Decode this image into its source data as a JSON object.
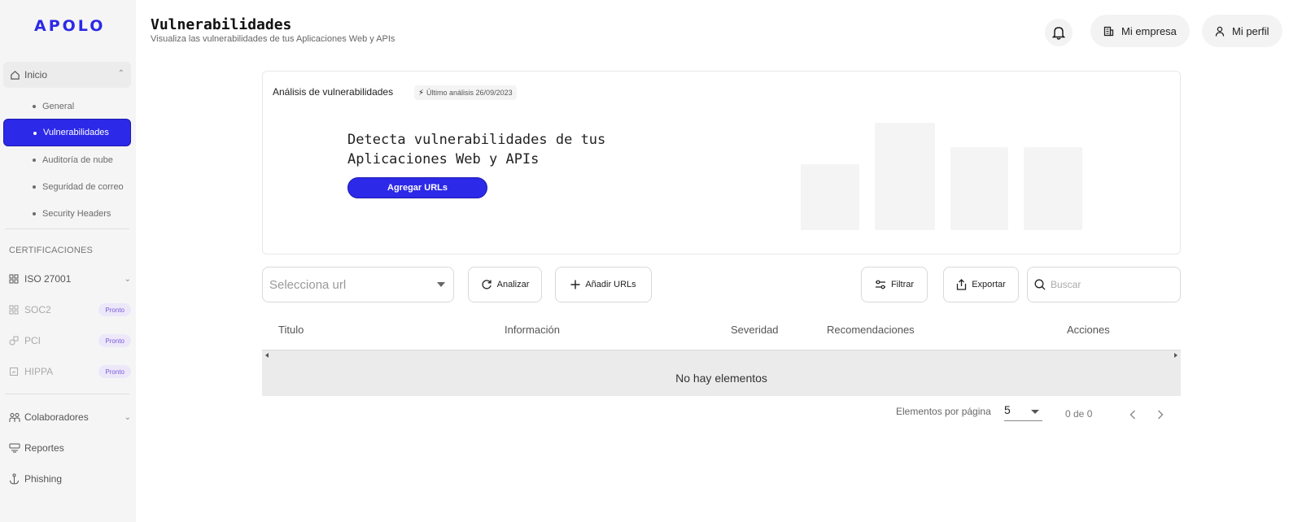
{
  "sidebar": {
    "logo": "APOLO",
    "inicio": {
      "label": "Inicio"
    },
    "subitems": [
      "General",
      "Vulnerabilidades",
      "Auditoría de nube",
      "Seguridad de correo",
      "Security Headers"
    ],
    "certifications_title": "CERTIFICACIONES",
    "certifications": [
      {
        "label": "ISO 27001",
        "badge": ""
      },
      {
        "label": "SOC2",
        "badge": "Pronto"
      },
      {
        "label": "PCI",
        "badge": "Pronto"
      },
      {
        "label": "HIPPA",
        "badge": "Pronto"
      }
    ],
    "bottom": [
      "Colaboradores",
      "Reportes",
      "Phishing"
    ]
  },
  "header": {
    "title": "Vulnerabilidades",
    "subtitle": "Visualiza las vulnerabilidades de tus Aplicaciones Web y APIs",
    "company_label": "Mi empresa",
    "profile_label": "Mi perfil"
  },
  "card": {
    "title": "Análisis de vulnerabilidades",
    "last_analysis": "Último análisis 26/09/2023",
    "hero_line1": "Detecta vulnerabilidades de tus",
    "hero_line2": "Aplicaciones Web y APIs",
    "cta_label": "Agregar URLs"
  },
  "toolbar": {
    "select_placeholder": "Selecciona url",
    "analyze_label": "Analizar",
    "add_urls_label": "Añadir URLs",
    "filter_label": "Filtrar",
    "export_label": "Exportar",
    "search_placeholder": "Buscar"
  },
  "table": {
    "columns": [
      "Titulo",
      "Información",
      "Severidad",
      "Recomendaciones",
      "Acciones"
    ],
    "empty_message": "No hay elementos"
  },
  "pagination": {
    "per_page_label": "Elementos por página",
    "per_page_value": "5",
    "range": "0 de 0"
  },
  "colors": {
    "accent": "#2c29e8",
    "badge_bg": "#ece8fa",
    "badge_text": "#7a5bd6"
  }
}
